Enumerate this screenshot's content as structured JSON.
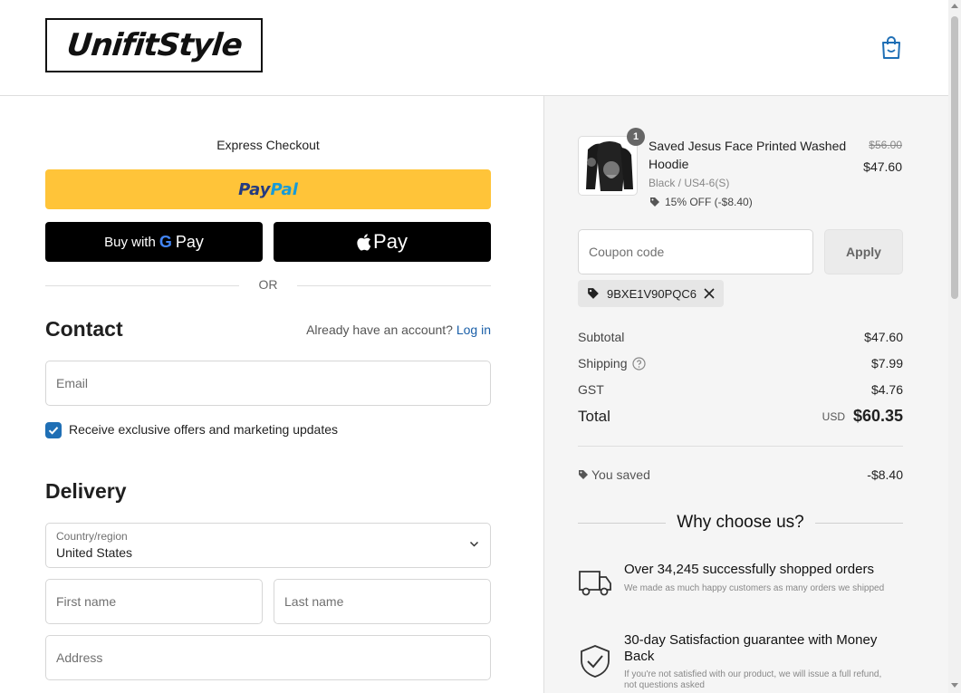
{
  "header": {
    "logo_text": "UnifitStyle",
    "cart_icon": "shopping-bag-icon"
  },
  "express": {
    "title": "Express Checkout",
    "paypal": {
      "part1": "Pay",
      "part2": "Pal"
    },
    "gpay": {
      "prefix": "Buy with",
      "g": "G",
      "suffix": "Pay"
    },
    "apay": {
      "suffix": "Pay"
    },
    "or_label": "OR"
  },
  "contact": {
    "heading": "Contact",
    "account_prompt": "Already have an account?",
    "login_link": "Log in",
    "email_placeholder": "Email",
    "marketing_checked": true,
    "marketing_label": "Receive exclusive offers and marketing updates"
  },
  "delivery": {
    "heading": "Delivery",
    "country_label": "Country/region",
    "country_value": "United States",
    "first_name_placeholder": "First name",
    "last_name_placeholder": "Last name",
    "address_placeholder": "Address"
  },
  "order": {
    "item": {
      "quantity": "1",
      "title": "Saved Jesus Face Printed Washed Hoodie",
      "variant": "Black / US4-6(S)",
      "discount": "15% OFF (-$8.40)",
      "price_original": "$56.00",
      "price_current": "$47.60"
    },
    "coupon_placeholder": "Coupon code",
    "apply_label": "Apply",
    "applied_code": "9BXE1V90PQC6",
    "subtotal_label": "Subtotal",
    "subtotal_value": "$47.60",
    "shipping_label": "Shipping",
    "shipping_value": "$7.99",
    "gst_label": "GST",
    "gst_value": "$4.76",
    "total_label": "Total",
    "total_currency": "USD",
    "total_value": "$60.35",
    "saved_label": "You saved",
    "saved_value": "-$8.40"
  },
  "why": {
    "heading": "Why choose us?",
    "features": [
      {
        "icon": "truck-icon",
        "title": "Over 34,245 successfully shopped orders",
        "desc": "We made as much happy customers as many orders we shipped"
      },
      {
        "icon": "shield-check-icon",
        "title": "30-day Satisfaction guarantee with Money Back",
        "desc": "If you're not satisfied with our product, we will issue a full refund, not questions asked"
      }
    ]
  },
  "colors": {
    "accent": "#1f6fb5",
    "paypal_yellow": "#ffc439",
    "sidebar_bg": "#f5f5f5"
  }
}
